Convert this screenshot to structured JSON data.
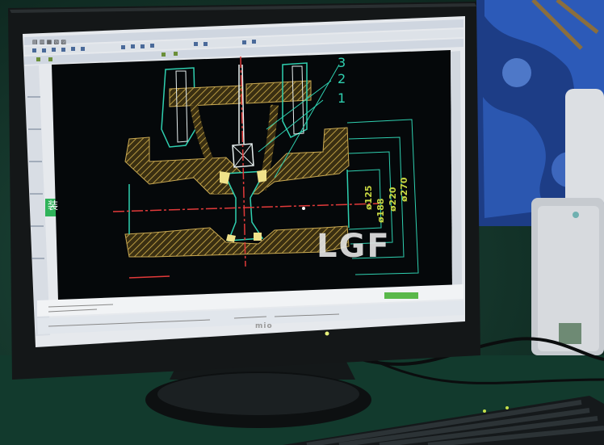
{
  "monitor": {
    "brand": "mio"
  },
  "cad_app": {
    "side_tab": "装",
    "callouts": [
      "3",
      "2",
      "1"
    ],
    "dimensions": [
      "ø125",
      "ø188",
      "ø220",
      "ø270"
    ]
  },
  "watermark": {
    "text": "LGF"
  },
  "colors": {
    "drawing_background": "#05080a",
    "hatching": "#a58a3c",
    "dimension_lines": "#2fd0b0",
    "center_lines": "#e23a3a",
    "accent_yellow": "#f0e28a",
    "ui_chrome": "#e9ecf0"
  }
}
